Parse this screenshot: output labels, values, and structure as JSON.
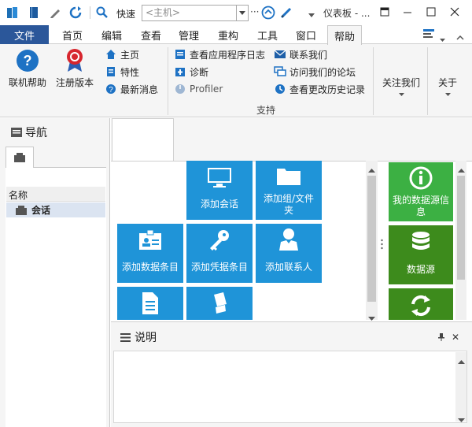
{
  "qat": {
    "quick_connect_label": "快速",
    "host_placeholder": "<主机>",
    "more": "···"
  },
  "window": {
    "title": "仪表板 - ..."
  },
  "tabs": {
    "file": "文件",
    "items": [
      "首页",
      "编辑",
      "查看",
      "管理",
      "重构",
      "工具",
      "窗口",
      "帮助"
    ]
  },
  "ribbon": {
    "online_help": "联机帮助",
    "register": "注册版本",
    "home": "主页",
    "features": "特性",
    "news": "最新消息",
    "view_app_log": "查看应用程序日志",
    "diagnostics": "诊断",
    "profiler": "Profiler",
    "contact_us": "联系我们",
    "forum": "访问我们的论坛",
    "history": "查看更改历史记录",
    "group_support": "支持",
    "follow_us": "关注我们",
    "about": "关于"
  },
  "nav": {
    "title": "导航",
    "column_name": "名称",
    "session_item": "会话"
  },
  "tiles": {
    "add_session": "添加会话",
    "add_group_l1": "添加组/文件",
    "add_group_l2": "夹",
    "add_data_entry": "添加数据条目",
    "add_credential": "添加凭据条目",
    "add_contact": "添加联系人",
    "my_datasource_l1": "我的数据源信",
    "my_datasource_l2": "息",
    "datasource": "数据源"
  },
  "description": {
    "title": "说明",
    "pin": "ᵖ",
    "close": "✕"
  },
  "colors": {
    "accent": "#2b579a",
    "tile_blue": "#1f94d8",
    "tile_green": "#3cb043",
    "tile_dark_green": "#3d8b1c"
  }
}
